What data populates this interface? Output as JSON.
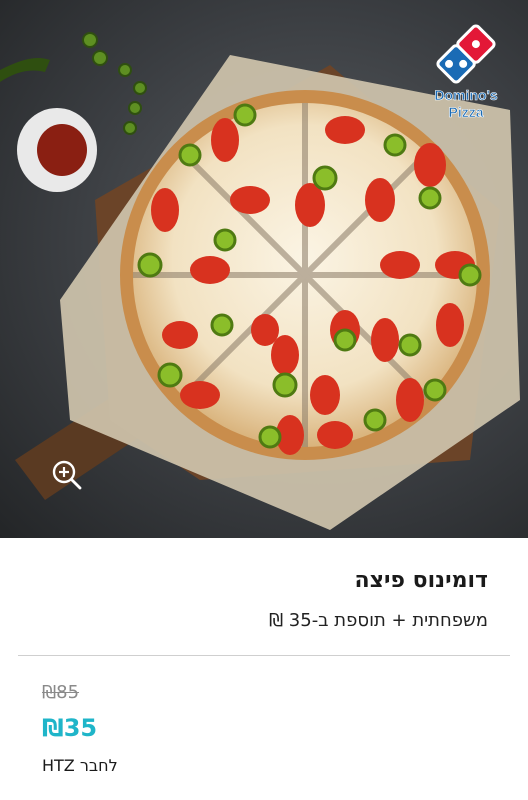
{
  "product": {
    "image_alt": "Domino's pizza",
    "logo_text_line1": "Domino's",
    "logo_text_line2": "Pizza",
    "title": "דומינוס פיצה",
    "subtitle": "משפחתית + תוספת ב-35 ₪",
    "old_price": "₪85",
    "price": "₪35",
    "club_label": "לחבר HTZ"
  },
  "colors": {
    "price_accent": "#1fb5c9",
    "logo_blue": "#1a6bb5",
    "logo_red": "#e31837",
    "divider": "#cfcfcf"
  },
  "icons": {
    "zoom": "zoom-in-icon"
  }
}
